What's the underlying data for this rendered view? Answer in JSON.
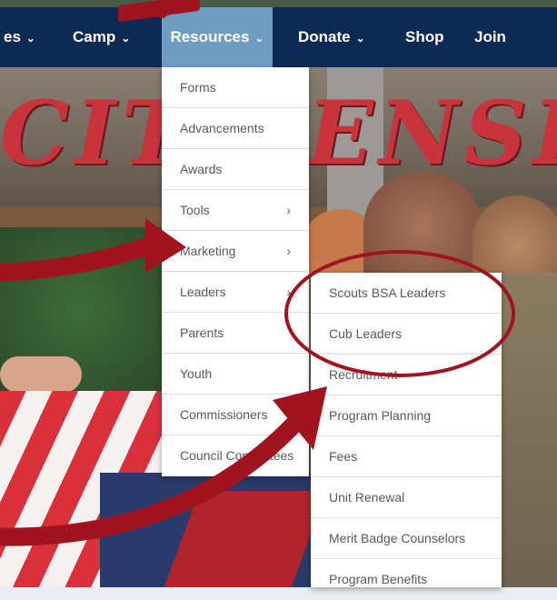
{
  "nav": {
    "items": [
      {
        "label": "es",
        "has_caret": true
      },
      {
        "label": "Camp",
        "has_caret": true
      },
      {
        "label": "Resources",
        "has_caret": true,
        "active": true
      },
      {
        "label": "Donate",
        "has_caret": true
      },
      {
        "label": "Shop",
        "has_caret": false
      },
      {
        "label": "Join",
        "has_caret": false
      }
    ],
    "caret_glyph": "⌄",
    "bar_color": "#0f2a52",
    "active_color": "#6f9cc1"
  },
  "hero": {
    "banner_word": "CITIZENSHIP"
  },
  "resources_menu": {
    "items": [
      {
        "label": "Forms"
      },
      {
        "label": "Advancements"
      },
      {
        "label": "Awards"
      },
      {
        "label": "Tools",
        "submenu": true
      },
      {
        "label": "Marketing",
        "submenu": true
      },
      {
        "label": "Leaders",
        "submenu": true
      },
      {
        "label": "Parents"
      },
      {
        "label": "Youth"
      },
      {
        "label": "Commissioners"
      },
      {
        "label": "Council Committees"
      }
    ],
    "chevron_glyph": "›"
  },
  "leaders_submenu": {
    "items": [
      {
        "label": "Scouts BSA Leaders"
      },
      {
        "label": "Cub Leaders"
      },
      {
        "label": "Recruitment"
      },
      {
        "label": "Program Planning"
      },
      {
        "label": "Fees"
      },
      {
        "label": "Unit Renewal"
      },
      {
        "label": "Merit Badge Counselors"
      },
      {
        "label": "Program Benefits"
      }
    ]
  },
  "annotation": {
    "color": "#a0141f",
    "arrow_icons": [
      "curved-arrow-icon",
      "curved-arrow-icon",
      "curved-arrow-icon"
    ],
    "circle_icon": "highlight-ellipse-icon"
  }
}
